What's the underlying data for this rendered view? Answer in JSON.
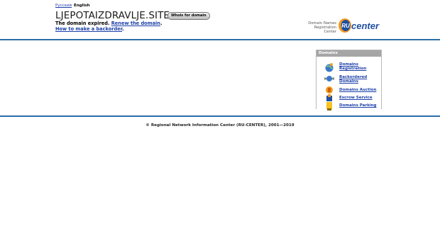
{
  "header": {
    "lang_ru": "Русский",
    "lang_en": "English",
    "domain": "LJEPOTAIZDRAVLJE.SITE",
    "whois_button": "Whois for domain",
    "expired_text": "The domain expired.",
    "renew_link": "Renew the domain",
    "renew_suffix": ".",
    "backorder_link": "How to make a backorder",
    "backorder_suffix": ".",
    "registrar_line1": "Domain Names",
    "registrar_line2": "Registration",
    "registrar_line3": "Center",
    "logo_text": "center",
    "logo_letter": "RU"
  },
  "panel": {
    "title": "Domains",
    "items": [
      {
        "label_1": "Domains",
        "label_2": "Registration",
        "icon": "globe-icon"
      },
      {
        "label_1": "Backordered",
        "label_2": "Domains",
        "icon": "winged-globe-icon"
      },
      {
        "label_1": "Domains Auction",
        "label_2": "",
        "icon": "auction-icon"
      },
      {
        "label_1": "Escrow Service",
        "label_2": "",
        "icon": "escrow-icon"
      },
      {
        "label_1": "Domains Parking",
        "label_2": "",
        "icon": "parking-icon"
      }
    ]
  },
  "footer": {
    "copyright": "© Regional Network Information Center (RU-CENTER), 2001—2019"
  },
  "colors": {
    "link": "#1a3ea8",
    "rule": "#2a6ea7",
    "panel_header": "#a6a6a6",
    "logo_orange": "#f39a1e",
    "logo_blue": "#1e4fa0"
  }
}
